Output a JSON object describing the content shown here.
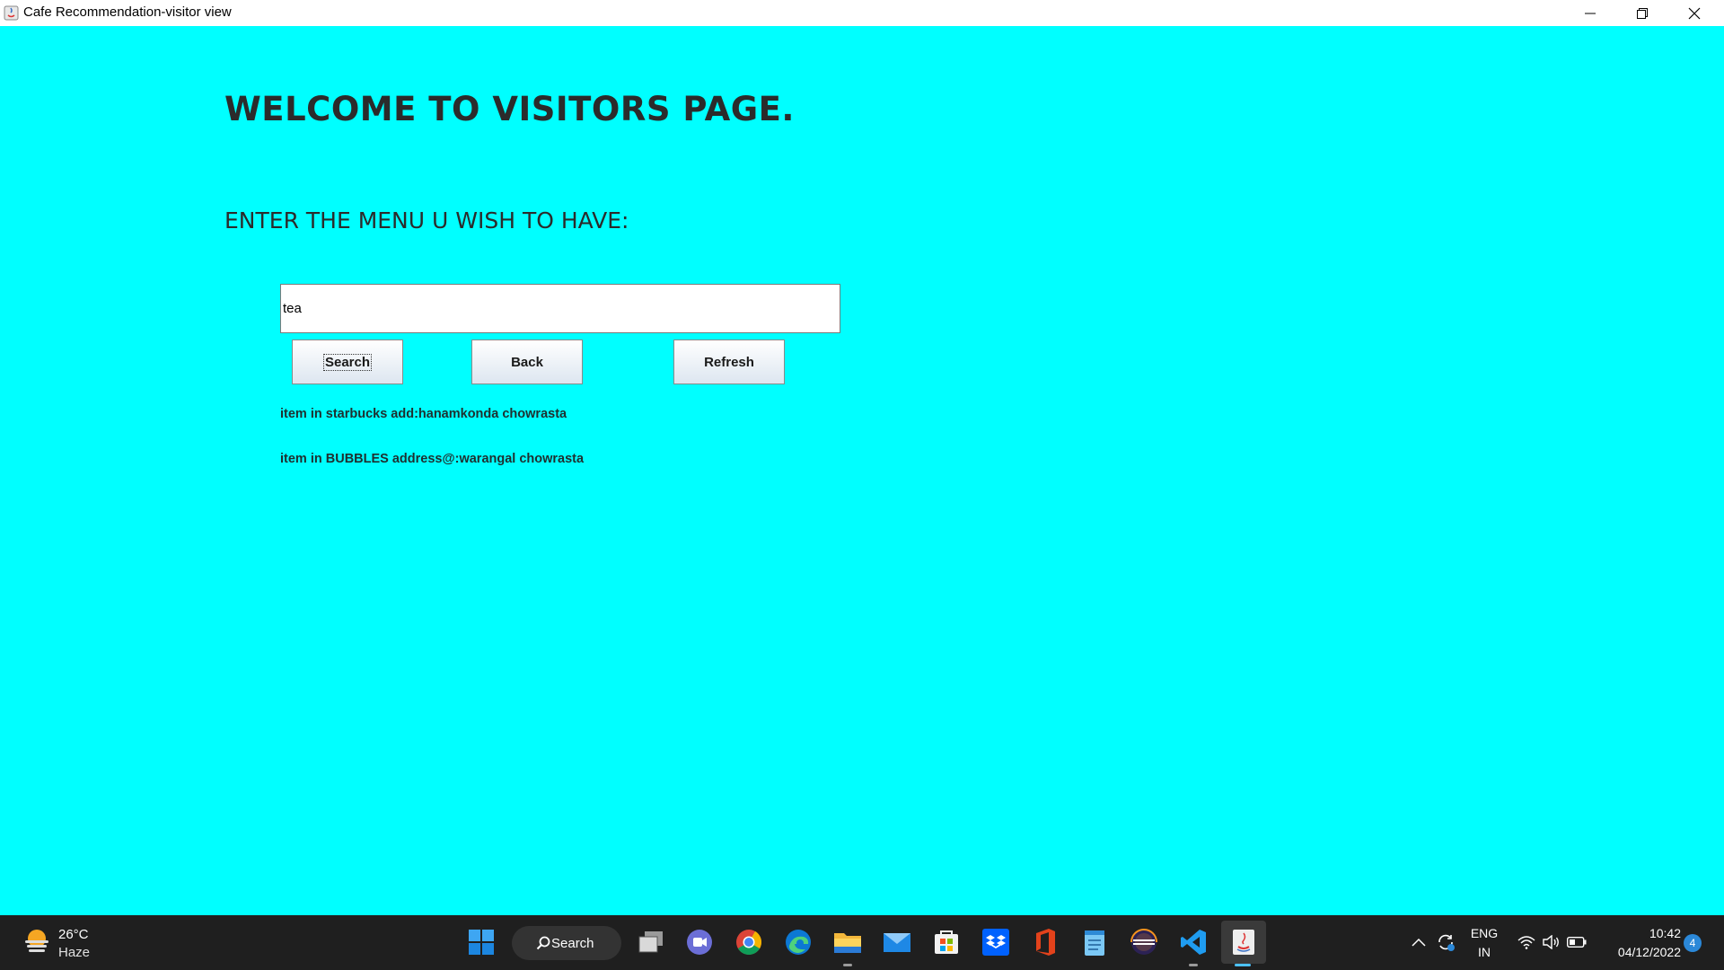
{
  "window": {
    "title": "Cafe Recommendation-visitor view",
    "controls": [
      "minimize",
      "restore",
      "close"
    ]
  },
  "page": {
    "heading": "WELCOME TO VISITORS PAGE.",
    "prompt": "ENTER THE MENU U WISH TO HAVE:",
    "search_value": "tea",
    "buttons": {
      "search": "Search",
      "back": "Back",
      "refresh": "Refresh"
    },
    "results": [
      "item in starbucks add:hanamkonda chowrasta",
      "item in BUBBLES address@:warangal chowrasta"
    ],
    "background_color": "#00ffff"
  },
  "taskbar": {
    "weather": {
      "temp": "26°C",
      "condition": "Haze",
      "icon": "weather-haze-icon"
    },
    "search_label": "Search",
    "pinned_icons": [
      "windows-start-icon",
      "search-icon",
      "task-view-icon",
      "teams-chat-icon",
      "chrome-icon",
      "edge-icon",
      "file-explorer-icon",
      "mail-icon",
      "microsoft-store-icon",
      "dropbox-icon",
      "office-icon",
      "notepad-icon",
      "eclipse-icon",
      "vscode-icon",
      "java-icon"
    ],
    "tray": {
      "language_line1": "ENG",
      "language_line2": "IN",
      "time": "10:42",
      "date": "04/12/2022",
      "notifications": "4"
    }
  }
}
